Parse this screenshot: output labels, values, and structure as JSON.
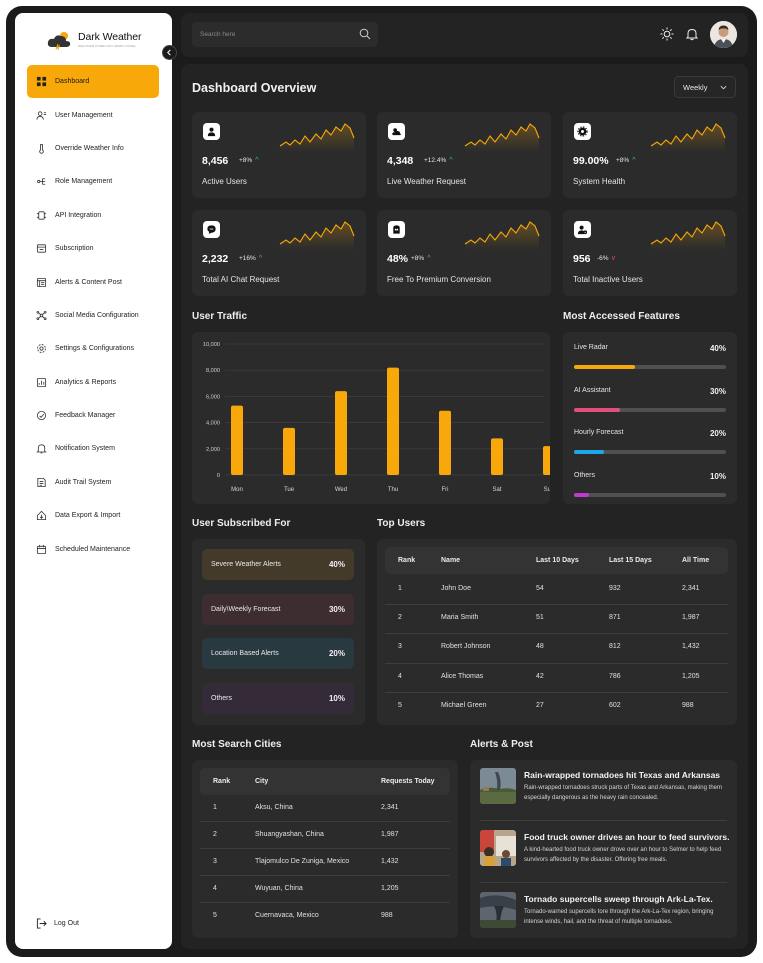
{
  "brand": {
    "name": "Dark Weather",
    "tagline": "WEATHER FORECAST ADMIN PANEL"
  },
  "sidebar": {
    "items": [
      {
        "label": "Dashboard",
        "icon": "dashboard-icon",
        "active": true
      },
      {
        "label": "User Management",
        "icon": "user-management-icon"
      },
      {
        "label": "Override Weather Info",
        "icon": "thermometer-icon"
      },
      {
        "label": "Role Management",
        "icon": "role-icon"
      },
      {
        "label": "API Integration",
        "icon": "api-icon"
      },
      {
        "label": "Subscription",
        "icon": "subscription-icon"
      },
      {
        "label": "Alerts & Content Post",
        "icon": "alerts-content-icon"
      },
      {
        "label": "Social Media Configuration",
        "icon": "social-icon"
      },
      {
        "label": "Settings & Configurations",
        "icon": "settings-icon"
      },
      {
        "label": "Analytics & Reports",
        "icon": "analytics-icon"
      },
      {
        "label": "Feedback Manager",
        "icon": "feedback-icon"
      },
      {
        "label": "Notification System",
        "icon": "bell-icon"
      },
      {
        "label": "Audit Trail System",
        "icon": "audit-icon"
      },
      {
        "label": "Data Export & Import",
        "icon": "export-icon"
      },
      {
        "label": "Scheduled Maintenance",
        "icon": "calendar-icon"
      }
    ],
    "logout_label": "Log Out"
  },
  "topbar": {
    "search_placeholder": "Search here"
  },
  "dashboard": {
    "title": "Dashboard Overview",
    "period": "Weekly",
    "stats": [
      {
        "value": "8,456",
        "delta": "+8%",
        "trend": "up",
        "label": "Active Users",
        "icon": "user-icon"
      },
      {
        "value": "4,348",
        "delta": "+12.4%",
        "trend": "up",
        "label": "Live Weather Request",
        "icon": "weather-icon"
      },
      {
        "value": "99.00%",
        "delta": "+8%",
        "trend": "up",
        "label": "System Health",
        "icon": "gear-icon"
      },
      {
        "value": "2,232",
        "delta": "+16%",
        "trend": "up",
        "label": "Total AI Chat Request",
        "icon": "chat-icon"
      },
      {
        "value": "48%",
        "delta": "+8%",
        "trend": "up",
        "label": "Free To Premium Conversion",
        "icon": "crown-icon"
      },
      {
        "value": "956",
        "delta": "-6%",
        "trend": "down",
        "label": "Total Inactive Users",
        "icon": "inactive-user-icon"
      }
    ],
    "arrows": {
      "up": "^",
      "down": "v"
    }
  },
  "traffic": {
    "title": "User Traffic"
  },
  "chart_data": {
    "type": "bar",
    "categories": [
      "Mon",
      "Tue",
      "Wed",
      "Thu",
      "Fri",
      "Sat",
      "Sun"
    ],
    "values": [
      5300,
      3600,
      6400,
      8200,
      4900,
      2800,
      2200
    ],
    "ylim": [
      0,
      10000
    ],
    "yticks": [
      "0",
      "2,000",
      "4,000",
      "6,000",
      "8,000",
      "10,000"
    ],
    "title": "User Traffic",
    "xlabel": "",
    "ylabel": "",
    "grid": true,
    "color": "#f8a809"
  },
  "features": {
    "title": "Most Accessed Features",
    "items": [
      {
        "name": "Live Radar",
        "percent": "40%",
        "value": 0.4,
        "color": "#f8a809"
      },
      {
        "name": "AI Assistant",
        "percent": "30%",
        "value": 0.3,
        "color": "#e24f7a"
      },
      {
        "name": "Hourly Forecast",
        "percent": "20%",
        "value": 0.2,
        "color": "#1ea7e8"
      },
      {
        "name": "Others",
        "percent": "10%",
        "value": 0.1,
        "color": "#c13ad0"
      }
    ]
  },
  "subscribed": {
    "title": "User Subscribed For",
    "items": [
      {
        "name": "Severe Weather Alerts",
        "percent": "40%",
        "color": "#433a2a"
      },
      {
        "name": "Daily\\Weekly Forecast",
        "percent": "30%",
        "color": "#3e2d30"
      },
      {
        "name": "Location Based Alerts",
        "percent": "20%",
        "color": "#28393f"
      },
      {
        "name": "Others",
        "percent": "10%",
        "color": "#352b38"
      }
    ]
  },
  "top_users": {
    "title": "Top Users",
    "columns": [
      "Rank",
      "Name",
      "Last 10 Days",
      "Last 15 Days",
      "All Time"
    ],
    "rows": [
      [
        "1",
        "John Doe",
        "54",
        "932",
        "2,341"
      ],
      [
        "2",
        "Maria Smith",
        "51",
        "871",
        "1,987"
      ],
      [
        "3",
        "Robert Johnson",
        "48",
        "812",
        "1,432"
      ],
      [
        "4",
        "Alice Thomas",
        "42",
        "786",
        "1,205"
      ],
      [
        "5",
        "Michael Green",
        "27",
        "602",
        "988"
      ]
    ]
  },
  "cities": {
    "title": "Most Search Cities",
    "columns": [
      "Rank",
      "City",
      "Requests Today"
    ],
    "rows": [
      [
        "1",
        "Aksu, China",
        "2,341"
      ],
      [
        "2",
        "Shuangyashan, China",
        "1,987"
      ],
      [
        "3",
        "Tlajomulco De Zuniga, Mexico",
        "1,432"
      ],
      [
        "4",
        "Wuyuan, China",
        "1,205"
      ],
      [
        "5",
        "Cuernavaca, Mexico",
        "988"
      ]
    ]
  },
  "alerts": {
    "title": "Alerts & Post",
    "items": [
      {
        "title": "Rain-wrapped tornadoes hit Texas and Arkansas",
        "desc": "Rain-wrapped tornadoes struck parts of Texas and Arkansas, making them especially dangerous as the heavy rain concealed."
      },
      {
        "title": "Food truck owner drives an hour to feed survivors.",
        "desc": "A kind-hearted food truck owner drove over an hour to Selmer to help feed survivors affected by the disaster. Offering free meals."
      },
      {
        "title": "Tornado supercells sweep through Ark-La-Tex.",
        "desc": "Tornado-warned supercells tore through the Ark-La-Tex region, bringing intense winds, hail, and the threat of multiple tornadoes."
      }
    ]
  }
}
